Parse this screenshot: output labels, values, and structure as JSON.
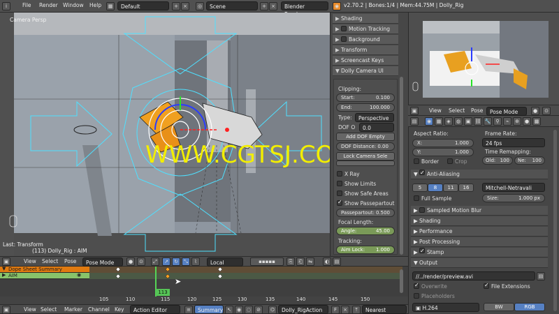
{
  "topbar": {
    "menus": [
      "File",
      "Render",
      "Window",
      "Help"
    ],
    "layout": "Default",
    "scene": "Scene",
    "engine": "Blender Render",
    "info": "v2.70.2 | Bones:1/4 | Mem:44.75M | Dolly_Rig"
  },
  "viewport": {
    "label": "Camera Persp",
    "last_op": "Last: Transform",
    "object_info": "(113) Dolly_Rig : AIM",
    "watermark": "WWW.CGTSJ.COM"
  },
  "viewport_header": {
    "menus": [
      "View",
      "Select",
      "Pose"
    ],
    "mode": "Pose Mode",
    "orientation": "Local"
  },
  "npanel": {
    "sections_top": [
      "Shading",
      "Motion Tracking",
      "Background Images",
      "Transform Orientations",
      "Screencast Keys"
    ],
    "dolly_title": "Dolly Camera UI",
    "clipping_label": "Clipping:",
    "start_label": "Start:",
    "start_value": "0.100",
    "end_label": "End:",
    "end_value": "100.000",
    "type_label": "Type:",
    "type_value": "Perspective",
    "dof_label": "DOF O",
    "dof_value": "0.0",
    "add_dof": "Add DOF Empty",
    "dof_distance": "DOF Distance: 0.00",
    "lock_camera": "Lock Camera Sele",
    "x_ray": "X Ray",
    "show_limits": "Show Limits",
    "show_safe": "Show Safe Areas",
    "show_passepartout": "Show Passepartout",
    "passepartout_label": "Passepartout:",
    "passepartout_value": "0.500",
    "focal_label": "Focal Length:",
    "angle_label": "Angle:",
    "angle_value": "45.00",
    "tracking_label": "Tracking:",
    "aim_label": "Aim Lock:",
    "aim_value": "1.000"
  },
  "dopesheet": {
    "summary": "Dope Sheet Summary",
    "channel": "AIM",
    "frame_current": "113",
    "ticks": [
      "105",
      "110",
      "115",
      "120",
      "125",
      "130",
      "135",
      "140",
      "145",
      "150"
    ]
  },
  "bottombar": {
    "menus": [
      "View",
      "Select",
      "Marker",
      "Channel",
      "Key"
    ],
    "editor": "Action Editor",
    "summary": "Summary",
    "action": "Dolly_RigAction",
    "fake_user": "F",
    "snap": "Nearest Frame"
  },
  "right_header": {
    "menus": [
      "View",
      "Select",
      "Pose"
    ],
    "mode": "Pose Mode"
  },
  "properties": {
    "aspect_label": "Aspect Ratio:",
    "x_label": "X:",
    "x_value": "1.000",
    "y_label": "Y:",
    "y_value": "1.000",
    "border": "Border",
    "crop": "Crop",
    "framerate_label": "Frame Rate:",
    "framerate_value": "24 fps",
    "remap_label": "Time Remapping:",
    "old_label": "Old:",
    "old_value": "100",
    "new_label": "Ne:",
    "new_value": "100",
    "aa_title": "Anti-Aliasing",
    "aa_samples": [
      "5",
      "8",
      "11",
      "16"
    ],
    "aa_filter": "Mitchell-Netravali",
    "full_sample": "Full Sample",
    "size_label": "Size:",
    "size_value": "1.000 px",
    "sections": [
      "Sampled Motion Blur",
      "Shading",
      "Performance",
      "Post Processing",
      "Stamp",
      "Output"
    ],
    "output_path": "//../render/preview.avi",
    "overwrite": "Overwrite",
    "file_ext": "File Extensions",
    "placeholders": "Placeholders",
    "codec": "H.264",
    "bw": "BW",
    "rgb": "RGB"
  },
  "colors": {
    "accent": "#5680c2",
    "green": "#7a9a58",
    "orange": "#e07a10",
    "cyan": "#4fe0ff",
    "watermark": "#f2ee00"
  }
}
